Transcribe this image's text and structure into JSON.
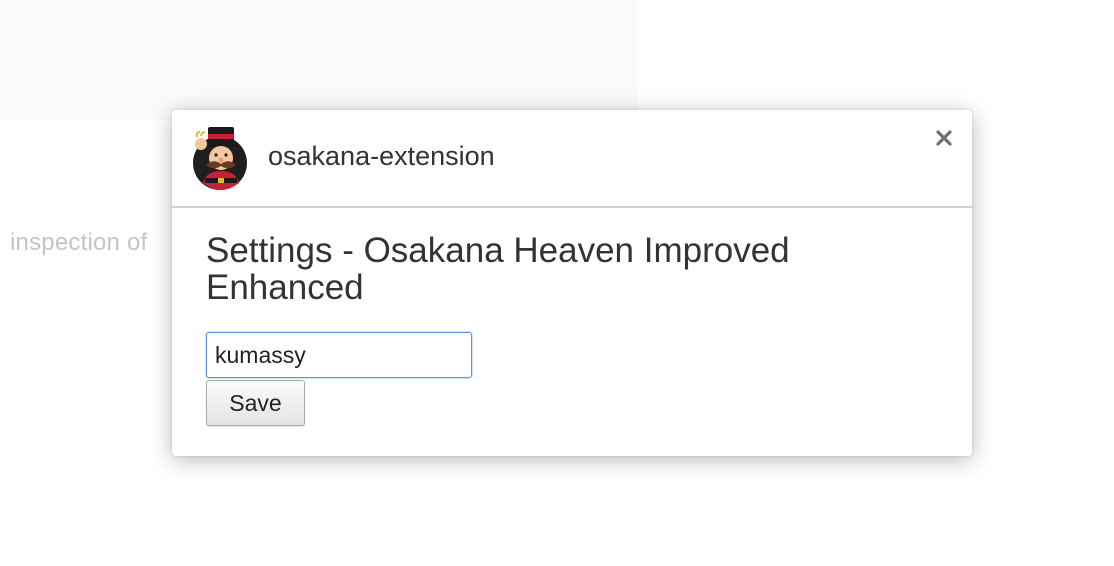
{
  "background": {
    "partial_text": "inspection of"
  },
  "dialog": {
    "extension_name": "osakana-extension",
    "extension_icon": "beefeater-mascot-icon",
    "close_icon": "close-icon",
    "settings_title": "Settings - Osakana Heaven Improved Enhanced",
    "input": {
      "value": "kumassy",
      "placeholder": ""
    },
    "save_label": "Save"
  },
  "colors": {
    "focus_ring": "#5a95e0",
    "header_divider": "#cfcfcf",
    "text": "#333333"
  }
}
